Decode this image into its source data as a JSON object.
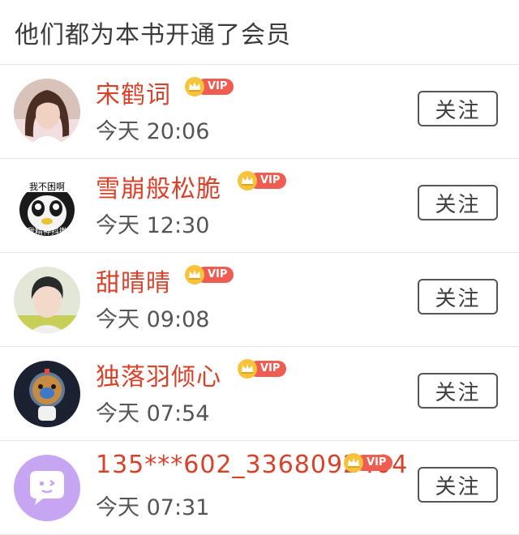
{
  "header": {
    "title": "他们都为本书开通了会员"
  },
  "vip_label": "VIP",
  "avatar_texts": {
    "panda_top": "我不困啊",
    "panda_bottom": "我精神抖擞"
  },
  "members": [
    {
      "name": "宋鹤词",
      "time": "今天 20:06",
      "follow_label": "关注",
      "avatar": "woman-photo"
    },
    {
      "name": "雪崩般松脆",
      "time": "今天 12:30",
      "follow_label": "关注",
      "avatar": "panda-meme"
    },
    {
      "name": "甜晴晴",
      "time": "今天 09:08",
      "follow_label": "关注",
      "avatar": "man-photo"
    },
    {
      "name": "独落羽倾心",
      "time": "今天 07:54",
      "follow_label": "关注",
      "avatar": "astronaut-bear"
    },
    {
      "name": "135***602_3368092404",
      "time": "今天 07:31",
      "follow_label": "关注",
      "avatar": "chat-bubble-icon"
    }
  ],
  "colors": {
    "name": "#d9422a",
    "vip_badge": "#ef5c52",
    "crown": "#f6c33a",
    "default_avatar": "#c6a6f2"
  }
}
